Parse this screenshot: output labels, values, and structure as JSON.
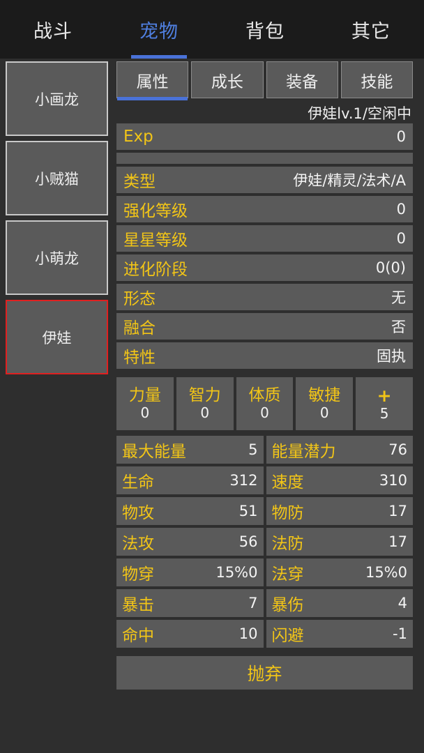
{
  "colors": {
    "background": "#2e2e2e",
    "panel": "#5a5a5a",
    "topbar": "#1b1b1b",
    "accent_blue": "#4a72d8",
    "label_yellow": "#f2c517",
    "value_white": "#f4f4f4",
    "selected_border_red": "#e02020",
    "card_border": "#c9c9c9"
  },
  "topnav": {
    "items": [
      {
        "label": "战斗",
        "active": false
      },
      {
        "label": "宠物",
        "active": true
      },
      {
        "label": "背包",
        "active": false
      },
      {
        "label": "其它",
        "active": false
      }
    ]
  },
  "sidebar": {
    "pets": [
      {
        "name": "小画龙",
        "selected": false
      },
      {
        "name": "小贼猫",
        "selected": false
      },
      {
        "name": "小萌龙",
        "selected": false
      },
      {
        "name": "伊娃",
        "selected": true
      }
    ]
  },
  "subtabs": {
    "items": [
      {
        "label": "属性",
        "active": true
      },
      {
        "label": "成长",
        "active": false
      },
      {
        "label": "装备",
        "active": false
      },
      {
        "label": "技能",
        "active": false
      }
    ]
  },
  "status": {
    "text": "伊娃lv.1/空闲中"
  },
  "exp": {
    "label": "Exp",
    "value": "0",
    "bar_percent": 0
  },
  "info_rows": [
    {
      "label": "类型",
      "value": "伊娃/精灵/法术/A"
    },
    {
      "label": "强化等级",
      "value": "0"
    },
    {
      "label": "星星等级",
      "value": "0"
    },
    {
      "label": "进化阶段",
      "value": "0(0)"
    },
    {
      "label": "形态",
      "value": "无"
    },
    {
      "label": "融合",
      "value": "否"
    },
    {
      "label": "特性",
      "value": "固执"
    }
  ],
  "attributes": [
    {
      "label": "力量",
      "value": "0"
    },
    {
      "label": "智力",
      "value": "0"
    },
    {
      "label": "体质",
      "value": "0"
    },
    {
      "label": "敏捷",
      "value": "0"
    },
    {
      "label": "+",
      "value": "5"
    }
  ],
  "stats": [
    {
      "label": "最大能量",
      "value": "5"
    },
    {
      "label": "能量潜力",
      "value": "76"
    },
    {
      "label": "生命",
      "value": "312"
    },
    {
      "label": "速度",
      "value": "310"
    },
    {
      "label": "物攻",
      "value": "51"
    },
    {
      "label": "物防",
      "value": "17"
    },
    {
      "label": "法攻",
      "value": "56"
    },
    {
      "label": "法防",
      "value": "17"
    },
    {
      "label": "物穿",
      "value": "15%0"
    },
    {
      "label": "法穿",
      "value": "15%0"
    },
    {
      "label": "暴击",
      "value": "7"
    },
    {
      "label": "暴伤",
      "value": "4"
    },
    {
      "label": "命中",
      "value": "10"
    },
    {
      "label": "闪避",
      "value": "-1"
    }
  ],
  "footer": {
    "discard_label": "抛弃"
  }
}
